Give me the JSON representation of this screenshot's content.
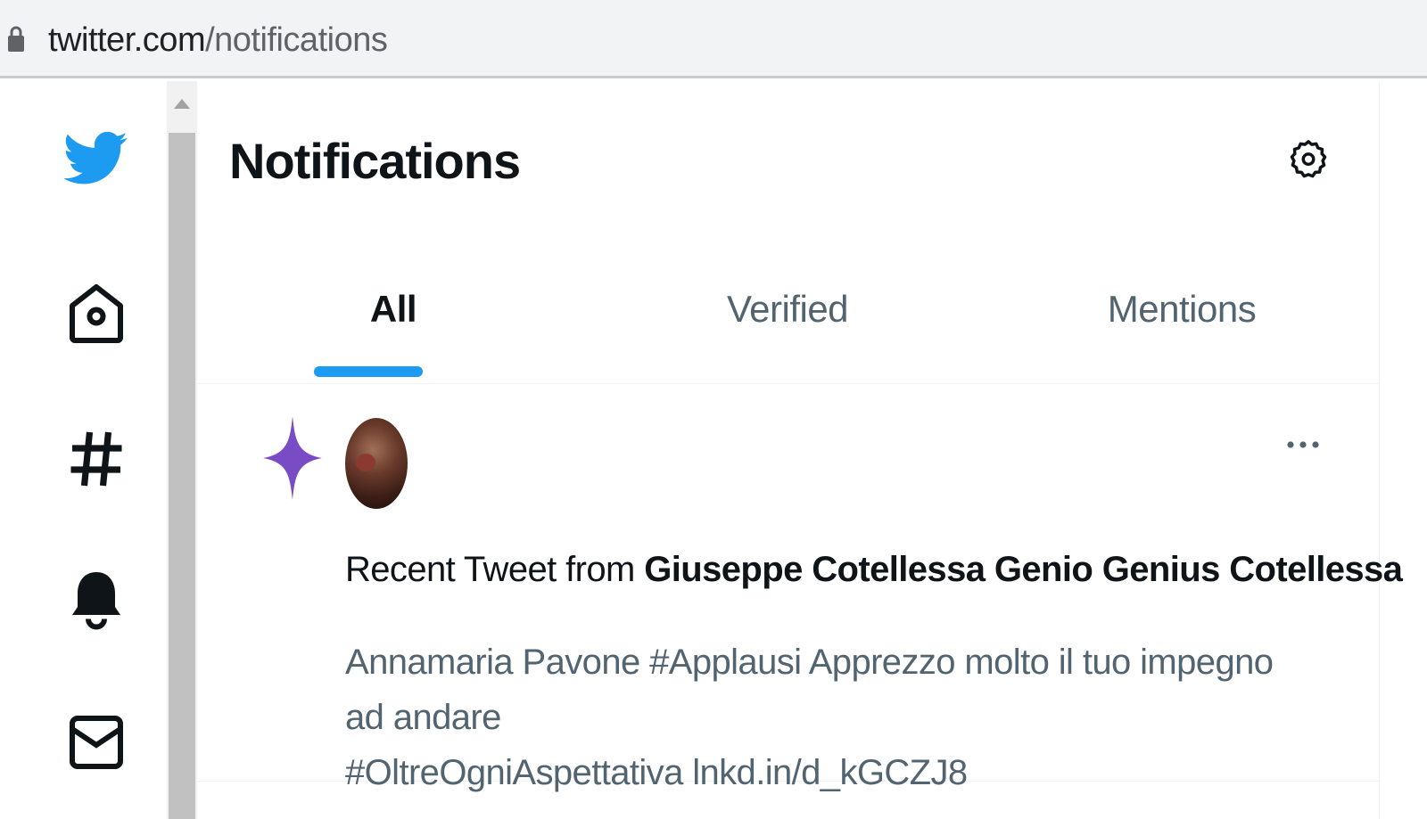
{
  "browser": {
    "url_domain": "twitter.com",
    "url_path": "/notifications"
  },
  "sidebar": {
    "items": [
      {
        "icon": "twitter-bird-logo",
        "color": "#1d9bf0"
      },
      {
        "icon": "home-icon"
      },
      {
        "icon": "explore-hashtag-icon"
      },
      {
        "icon": "notifications-bell-icon"
      },
      {
        "icon": "messages-envelope-icon"
      }
    ]
  },
  "header": {
    "title": "Notifications",
    "settings_icon": "gear-icon"
  },
  "tabs": [
    {
      "label": "All",
      "active": true
    },
    {
      "label": "Verified",
      "active": false
    },
    {
      "label": "Mentions",
      "active": false
    }
  ],
  "notification": {
    "icon": "sparkle-icon",
    "icon_color": "#794bc4",
    "prefix": "Recent Tweet from ",
    "author": "Giuseppe Cotellessa Genio Genius Cotellessa",
    "text_line1": "Annamaria Pavone #Applausi Apprezzo molto il tuo impegno ad andare",
    "text_line2": "#OltreOgniAspettativa lnkd.in/d_kGCZJ8"
  },
  "colors": {
    "accent": "#1d9bf0",
    "secondary_text": "#536471",
    "primary_text": "#0f1419"
  }
}
